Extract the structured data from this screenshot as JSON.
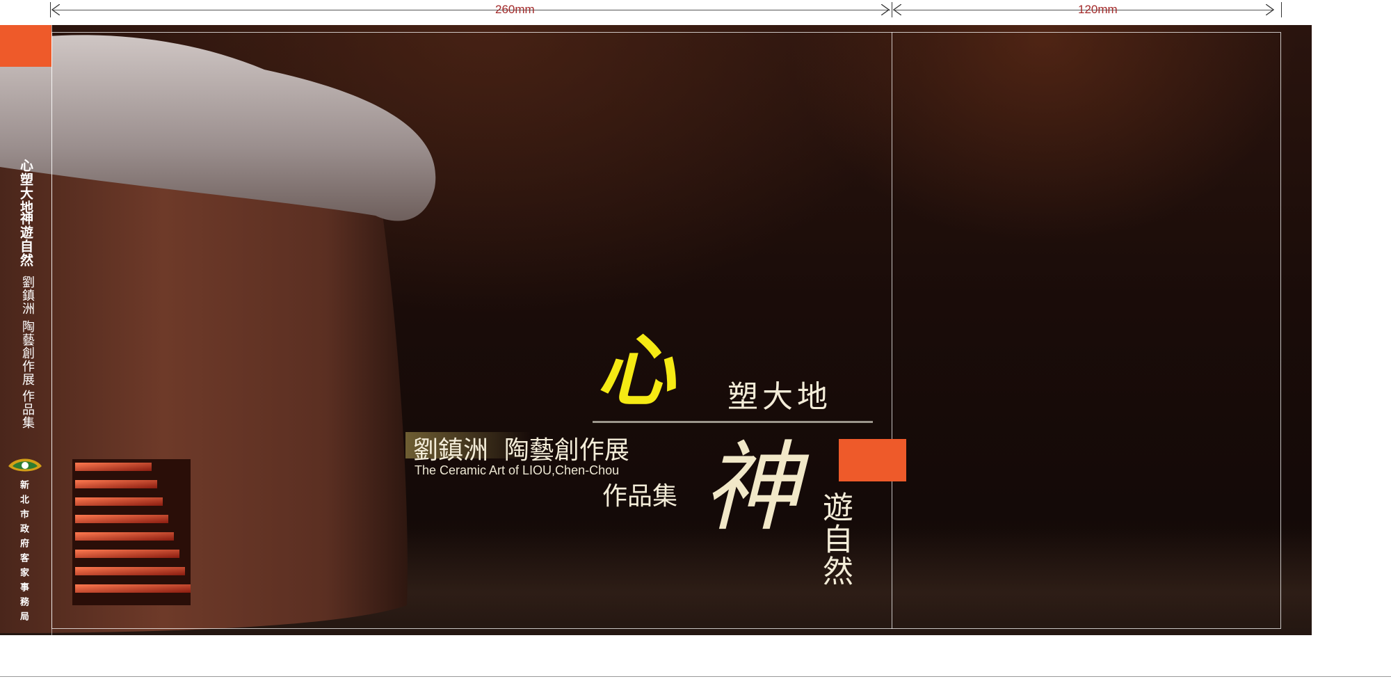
{
  "dimensions": {
    "left_width": "260mm",
    "right_width": "120mm"
  },
  "spine": {
    "title_line1": "心塑大地",
    "title_line2": "神遊自然",
    "author": "劉鎮洲",
    "exhibition": "陶藝創作展",
    "catalog": "作品集",
    "publisher": "新北市政府客家事務局"
  },
  "front": {
    "glyph_xin": "心",
    "phrase1_rest": "塑大地",
    "subtitle_cn": "劉鎮洲  陶藝創作展",
    "subtitle_en": "The Ceramic Art of LIOU,Chen-Chou",
    "catalog": "作品集",
    "glyph_shen": "神",
    "phrase2_rest": "遊自然"
  },
  "colors": {
    "accent_orange": "#ee5a2a",
    "xin_yellow": "#f5ea14",
    "text_cream": "#f3ecd8",
    "background_dark": "#1a0c09"
  }
}
